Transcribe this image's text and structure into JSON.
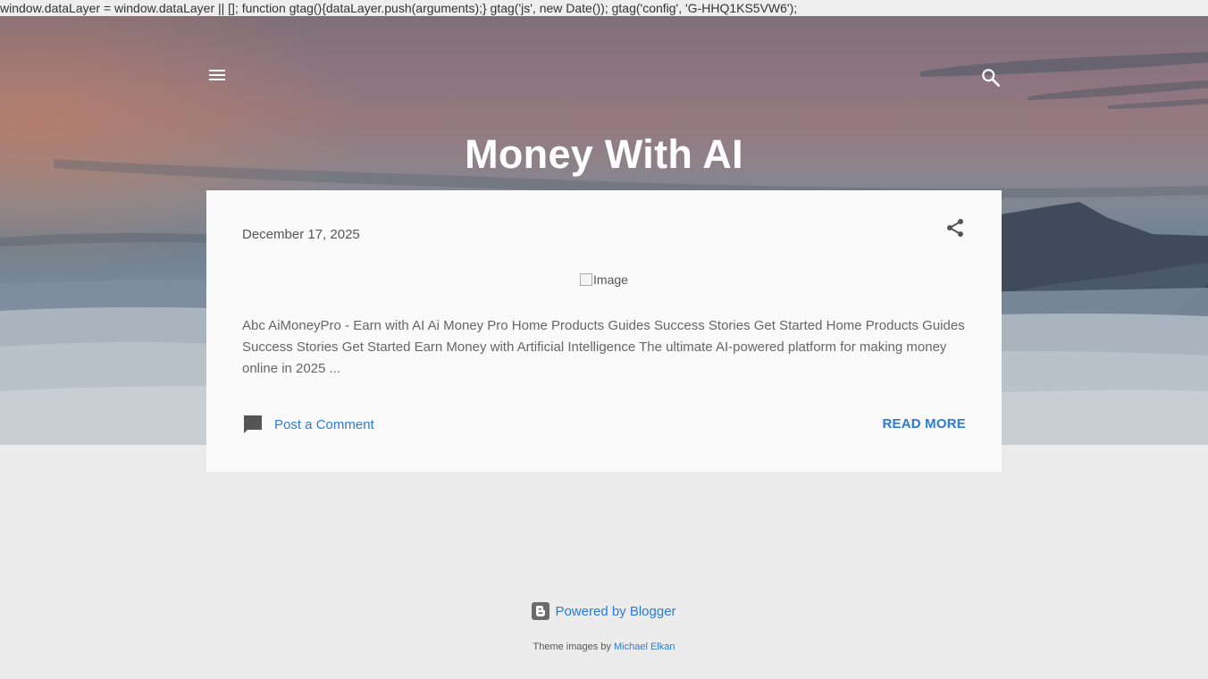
{
  "script_leak": "window.dataLayer = window.dataLayer || []; function gtag(){dataLayer.push(arguments);} gtag('js', new Date()); gtag('config', 'G-HHQ1KS5VW6');",
  "header": {
    "site_title": "Money With AI",
    "menu_icon": "hamburger-menu-icon",
    "search_icon": "search-icon"
  },
  "post": {
    "date": "December 17, 2025",
    "share_icon": "share-icon",
    "image_alt": "Image",
    "snippet": " Abc AiMoneyPro - Earn with AI Ai Money Pro Home Products Guides Success Stories Get Started Home Products Guides Success Stories Get Started Earn Money with Artificial Intelligence The ultimate AI-powered platform for making money online in 2025 ...",
    "comment_label": "Post a Comment",
    "comment_icon": "comment-icon",
    "read_more_label": "READ MORE"
  },
  "footer": {
    "powered_label": "Powered by Blogger",
    "blogger_icon": "blogger-icon",
    "theme_prefix": "Theme images by",
    "theme_author": "Michael Elkan"
  },
  "colors": {
    "link": "#2a7bd8",
    "page_bg": "#ececec",
    "card_bg": "#fafafa"
  }
}
